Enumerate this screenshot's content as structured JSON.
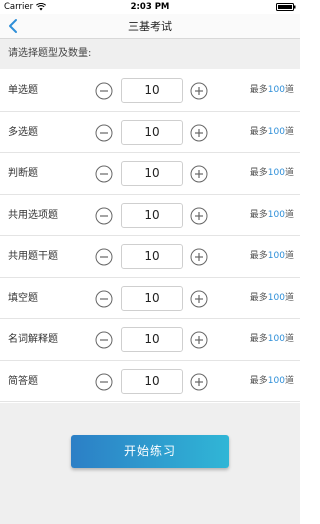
{
  "status_bar": {
    "carrier": "Carrier",
    "time": "2:03 PM"
  },
  "nav": {
    "title": "三基考试"
  },
  "section_header": "请选择题型及数量:",
  "max_prefix": "最多",
  "max_suffix": "道",
  "rows": [
    {
      "label": "单选题",
      "value": "10",
      "max": "100"
    },
    {
      "label": "多选题",
      "value": "10",
      "max": "100"
    },
    {
      "label": "判断题",
      "value": "10",
      "max": "100"
    },
    {
      "label": "共用选项题",
      "value": "10",
      "max": "100"
    },
    {
      "label": "共用题干题",
      "value": "10",
      "max": "100"
    },
    {
      "label": "填空题",
      "value": "10",
      "max": "100"
    },
    {
      "label": "名词解释题",
      "value": "10",
      "max": "100"
    },
    {
      "label": "简答题",
      "value": "10",
      "max": "100"
    }
  ],
  "start_button": "开始练习",
  "colors": {
    "accent": "#2f8fd8",
    "button_start": "#2c7fc6",
    "button_end": "#30b6d6",
    "header_bg": "#efefef"
  },
  "icons": {
    "back": "chevron-left-icon",
    "minus": "minus-circle-icon",
    "plus": "plus-circle-icon",
    "wifi": "wifi-icon",
    "battery": "battery-icon"
  }
}
